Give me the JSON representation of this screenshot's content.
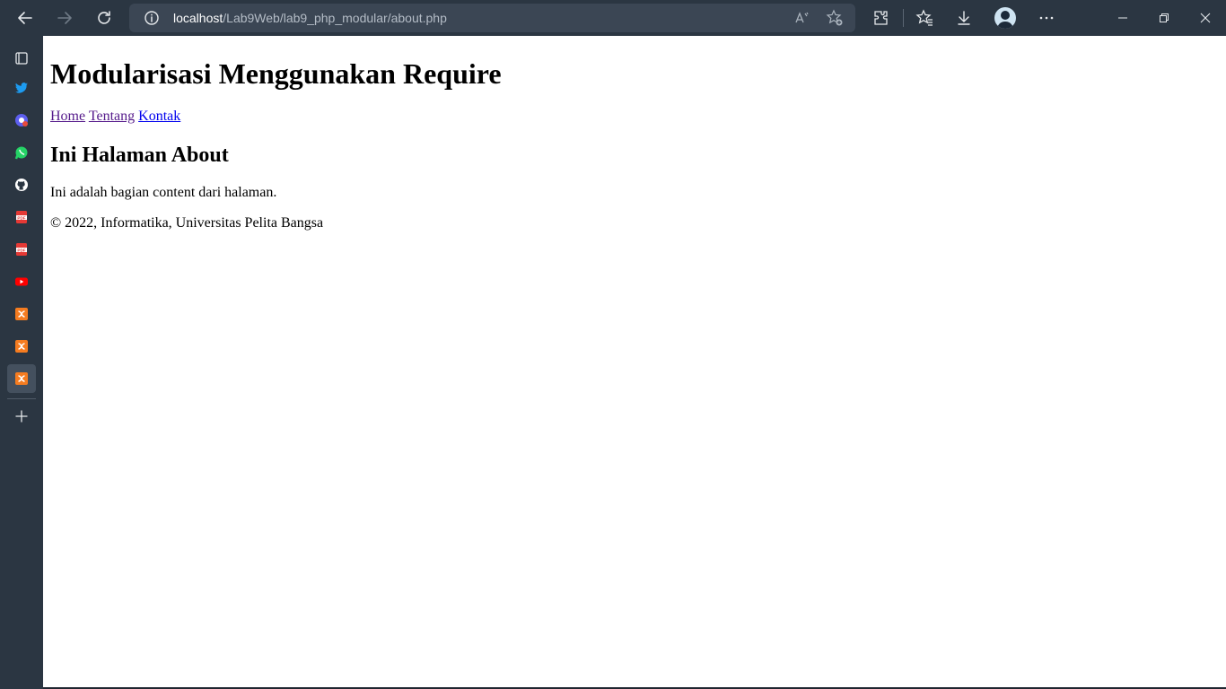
{
  "browser": {
    "address": {
      "host": "localhost",
      "path": "/Lab9Web/lab9_php_modular/about.php"
    },
    "toolbar_icons": [
      "back-arrow-icon",
      "forward-arrow-icon",
      "refresh-icon",
      "info-icon",
      "read-aloud-icon",
      "add-favorite-icon",
      "extensions-icon",
      "favorites-icon",
      "downloads-icon",
      "profile-avatar",
      "more-icon"
    ],
    "window_controls": [
      "minimize-icon",
      "restore-icon",
      "close-icon"
    ]
  },
  "sidebar": {
    "items": [
      {
        "name": "tab-actions-icon",
        "color": "#ffffff"
      },
      {
        "name": "twitter-icon",
        "color": "#1d9bf0"
      },
      {
        "name": "chrome-remote-icon",
        "color": "#e84b3c"
      },
      {
        "name": "whatsapp-icon",
        "color": "#25d366"
      },
      {
        "name": "github-icon",
        "color": "#ffffff"
      },
      {
        "name": "pdf-icon",
        "color": "#e53935"
      },
      {
        "name": "pdf-icon",
        "color": "#e53935"
      },
      {
        "name": "youtube-icon",
        "color": "#ff0000"
      },
      {
        "name": "xampp-icon",
        "color": "#f57c20"
      },
      {
        "name": "xampp-icon",
        "color": "#f57c20"
      },
      {
        "name": "xampp-icon",
        "color": "#f57c20"
      }
    ],
    "add_icon": "plus-icon"
  },
  "page": {
    "title": "Modularisasi Menggunakan Require",
    "nav": {
      "home": "Home",
      "tentang": "Tentang",
      "kontak": "Kontak"
    },
    "heading": "Ini Halaman About",
    "content": "Ini adalah bagian content dari halaman.",
    "footer": "© 2022, Informatika, Universitas Pelita Bangsa"
  },
  "colors": {
    "chrome_bg": "#2b3642",
    "address_bg": "#3b4654",
    "link_visited": "#551a8b",
    "link_unvisited": "#0000ee"
  }
}
